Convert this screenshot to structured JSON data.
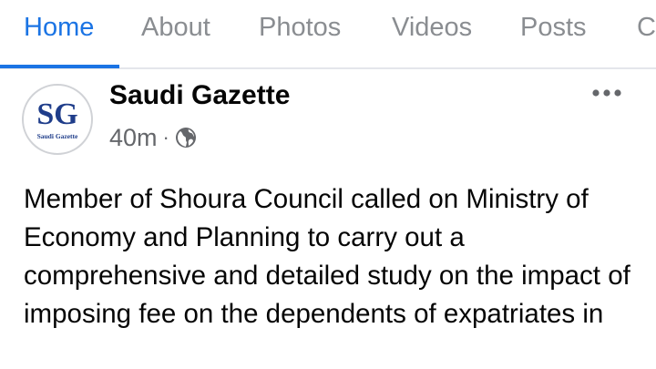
{
  "tabs": [
    {
      "label": "Home",
      "active": true
    },
    {
      "label": "About",
      "active": false
    },
    {
      "label": "Photos",
      "active": false
    },
    {
      "label": "Videos",
      "active": false
    },
    {
      "label": "Posts",
      "active": false
    },
    {
      "label": "C",
      "active": false
    }
  ],
  "post": {
    "avatar_initials": "SG",
    "avatar_caption": "Saudi Gazette",
    "page_name": "Saudi Gazette",
    "time": "40m",
    "separator": "·",
    "privacy_icon": "globe-icon",
    "more_icon": "more-options-icon",
    "text": "Member of Shoura Council called on Ministry of Economy and Planning to carry out a comprehensive and detailed study on the impact of imposing fee on the dependents of expatriates in"
  },
  "colors": {
    "accent": "#1b74e4",
    "tab_inactive": "#8a8d91",
    "text_primary": "#050505",
    "text_secondary": "#65676b",
    "logo": "#1f3d8a"
  }
}
